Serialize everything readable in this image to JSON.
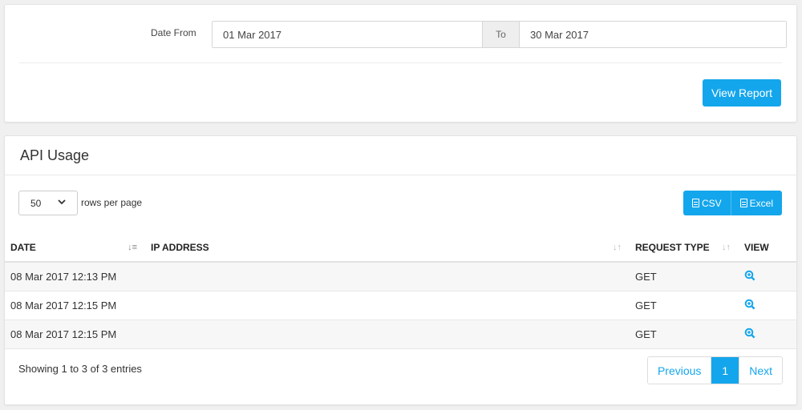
{
  "filter": {
    "date_from_label": "Date From",
    "date_from_value": "01 Mar 2017",
    "to_label": "To",
    "date_to_value": "30 Mar 2017",
    "view_report_label": "View Report"
  },
  "usage": {
    "title": "API Usage",
    "page_length": "50",
    "rows_per_page_label": "rows per page",
    "export_csv_label": "CSV",
    "export_excel_label": "Excel",
    "columns": {
      "date": "DATE",
      "ip_address": "IP ADDRESS",
      "request_type": "REQUEST TYPE",
      "view": "VIEW"
    },
    "rows": [
      {
        "date": "08 Mar 2017 12:13 PM",
        "ip_address": "",
        "request_type": "GET"
      },
      {
        "date": "08 Mar 2017 12:15 PM",
        "ip_address": "",
        "request_type": "GET"
      },
      {
        "date": "08 Mar 2017 12:15 PM",
        "ip_address": "",
        "request_type": "GET"
      }
    ],
    "info": "Showing 1 to 3 of 3 entries",
    "pagination": {
      "previous": "Previous",
      "current": "1",
      "next": "Next"
    }
  },
  "colors": {
    "accent": "#14a6ec",
    "background": "#f0f0f0"
  }
}
